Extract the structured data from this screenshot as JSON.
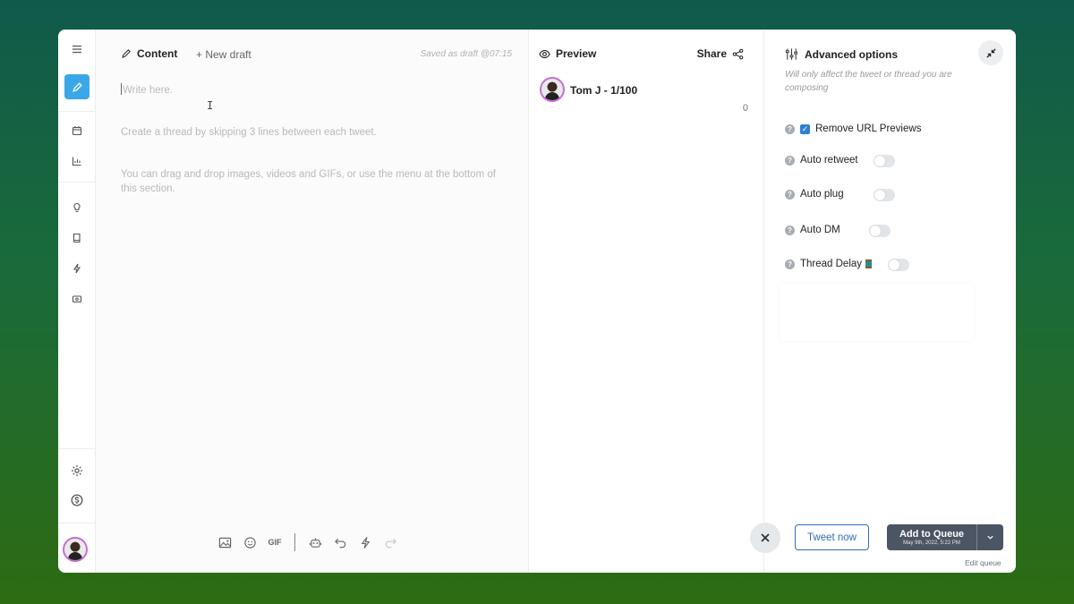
{
  "content": {
    "title": "Content",
    "new_draft": "+ New draft",
    "saved": "Saved as draft @07:15",
    "placeholder_1": "Write here.",
    "placeholder_2": "Create a thread by skipping 3 lines between each tweet.",
    "placeholder_3": "You can drag and drop images, videos and GIFs, or use the menu at the bottom of this section.",
    "gif_label": "GIF"
  },
  "preview": {
    "title": "Preview",
    "share": "Share",
    "author": "Tom J - 1/100",
    "char_count": "0"
  },
  "advanced": {
    "title": "Advanced options",
    "subtitle": "Will only affect the tweet or thread you are composing",
    "options": [
      {
        "label": "Remove URL Previews",
        "checked": true
      },
      {
        "label": "Auto retweet",
        "enabled": false
      },
      {
        "label": "Auto plug",
        "enabled": false
      },
      {
        "label": "Auto DM",
        "enabled": false
      },
      {
        "label": "Thread Delay",
        "enabled": false
      }
    ],
    "qmark": "?"
  },
  "actions": {
    "tweet_now": "Tweet now",
    "add_to_queue": "Add to Queue",
    "queue_date": "May 9th, 2022, 5:22 PM",
    "edit_queue": "Edit queue"
  },
  "colors": {
    "accent": "#3aa7e8",
    "primary_blue": "#2f6db5",
    "queue_button": "#4b5563"
  }
}
